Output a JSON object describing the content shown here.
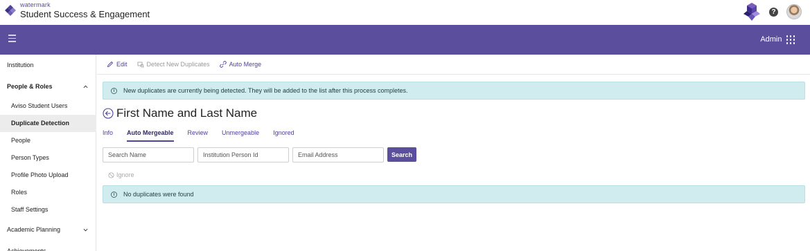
{
  "brand": {
    "small": "watermark",
    "title": "Student Success & Engagement"
  },
  "navbar": {
    "user_label": "Admin"
  },
  "sidebar": {
    "items": [
      {
        "label": "Institution"
      },
      {
        "label": "People & Roles"
      },
      {
        "label": "Aviso Student Users"
      },
      {
        "label": "Duplicate Detection"
      },
      {
        "label": "People"
      },
      {
        "label": "Person Types"
      },
      {
        "label": "Profile Photo Upload"
      },
      {
        "label": "Roles"
      },
      {
        "label": "Staff Settings"
      },
      {
        "label": "Academic Planning"
      },
      {
        "label": "Achievements"
      }
    ]
  },
  "toolbar": {
    "edit": "Edit",
    "detect": "Detect New Duplicates",
    "auto_merge": "Auto Merge"
  },
  "alerts": {
    "detecting": "New duplicates are currently being detected. They will be added to the list after this process completes.",
    "none_found": "No duplicates were found"
  },
  "page": {
    "title": "First Name and Last Name"
  },
  "tabs": [
    {
      "label": "Info"
    },
    {
      "label": "Auto Mergeable"
    },
    {
      "label": "Review"
    },
    {
      "label": "Unmergeable"
    },
    {
      "label": "Ignored"
    }
  ],
  "search": {
    "name_placeholder": "Search Name",
    "id_placeholder": "Institution Person Id",
    "email_placeholder": "Email Address",
    "button": "Search"
  },
  "actions": {
    "ignore": "Ignore"
  },
  "colors": {
    "brand_purple": "#5b4e9d",
    "alert_bg": "#d0ecee",
    "active_item_bg": "#ececec"
  },
  "icons": [
    "watermark-logo-icon",
    "app-logo-icon",
    "help-icon",
    "avatar",
    "hamburger-icon",
    "apps-grid-icon",
    "chevron-up-icon",
    "chevron-down-icon",
    "pencil-icon",
    "detect-icon",
    "link-icon",
    "info-icon",
    "back-arrow-icon",
    "ban-icon"
  ]
}
